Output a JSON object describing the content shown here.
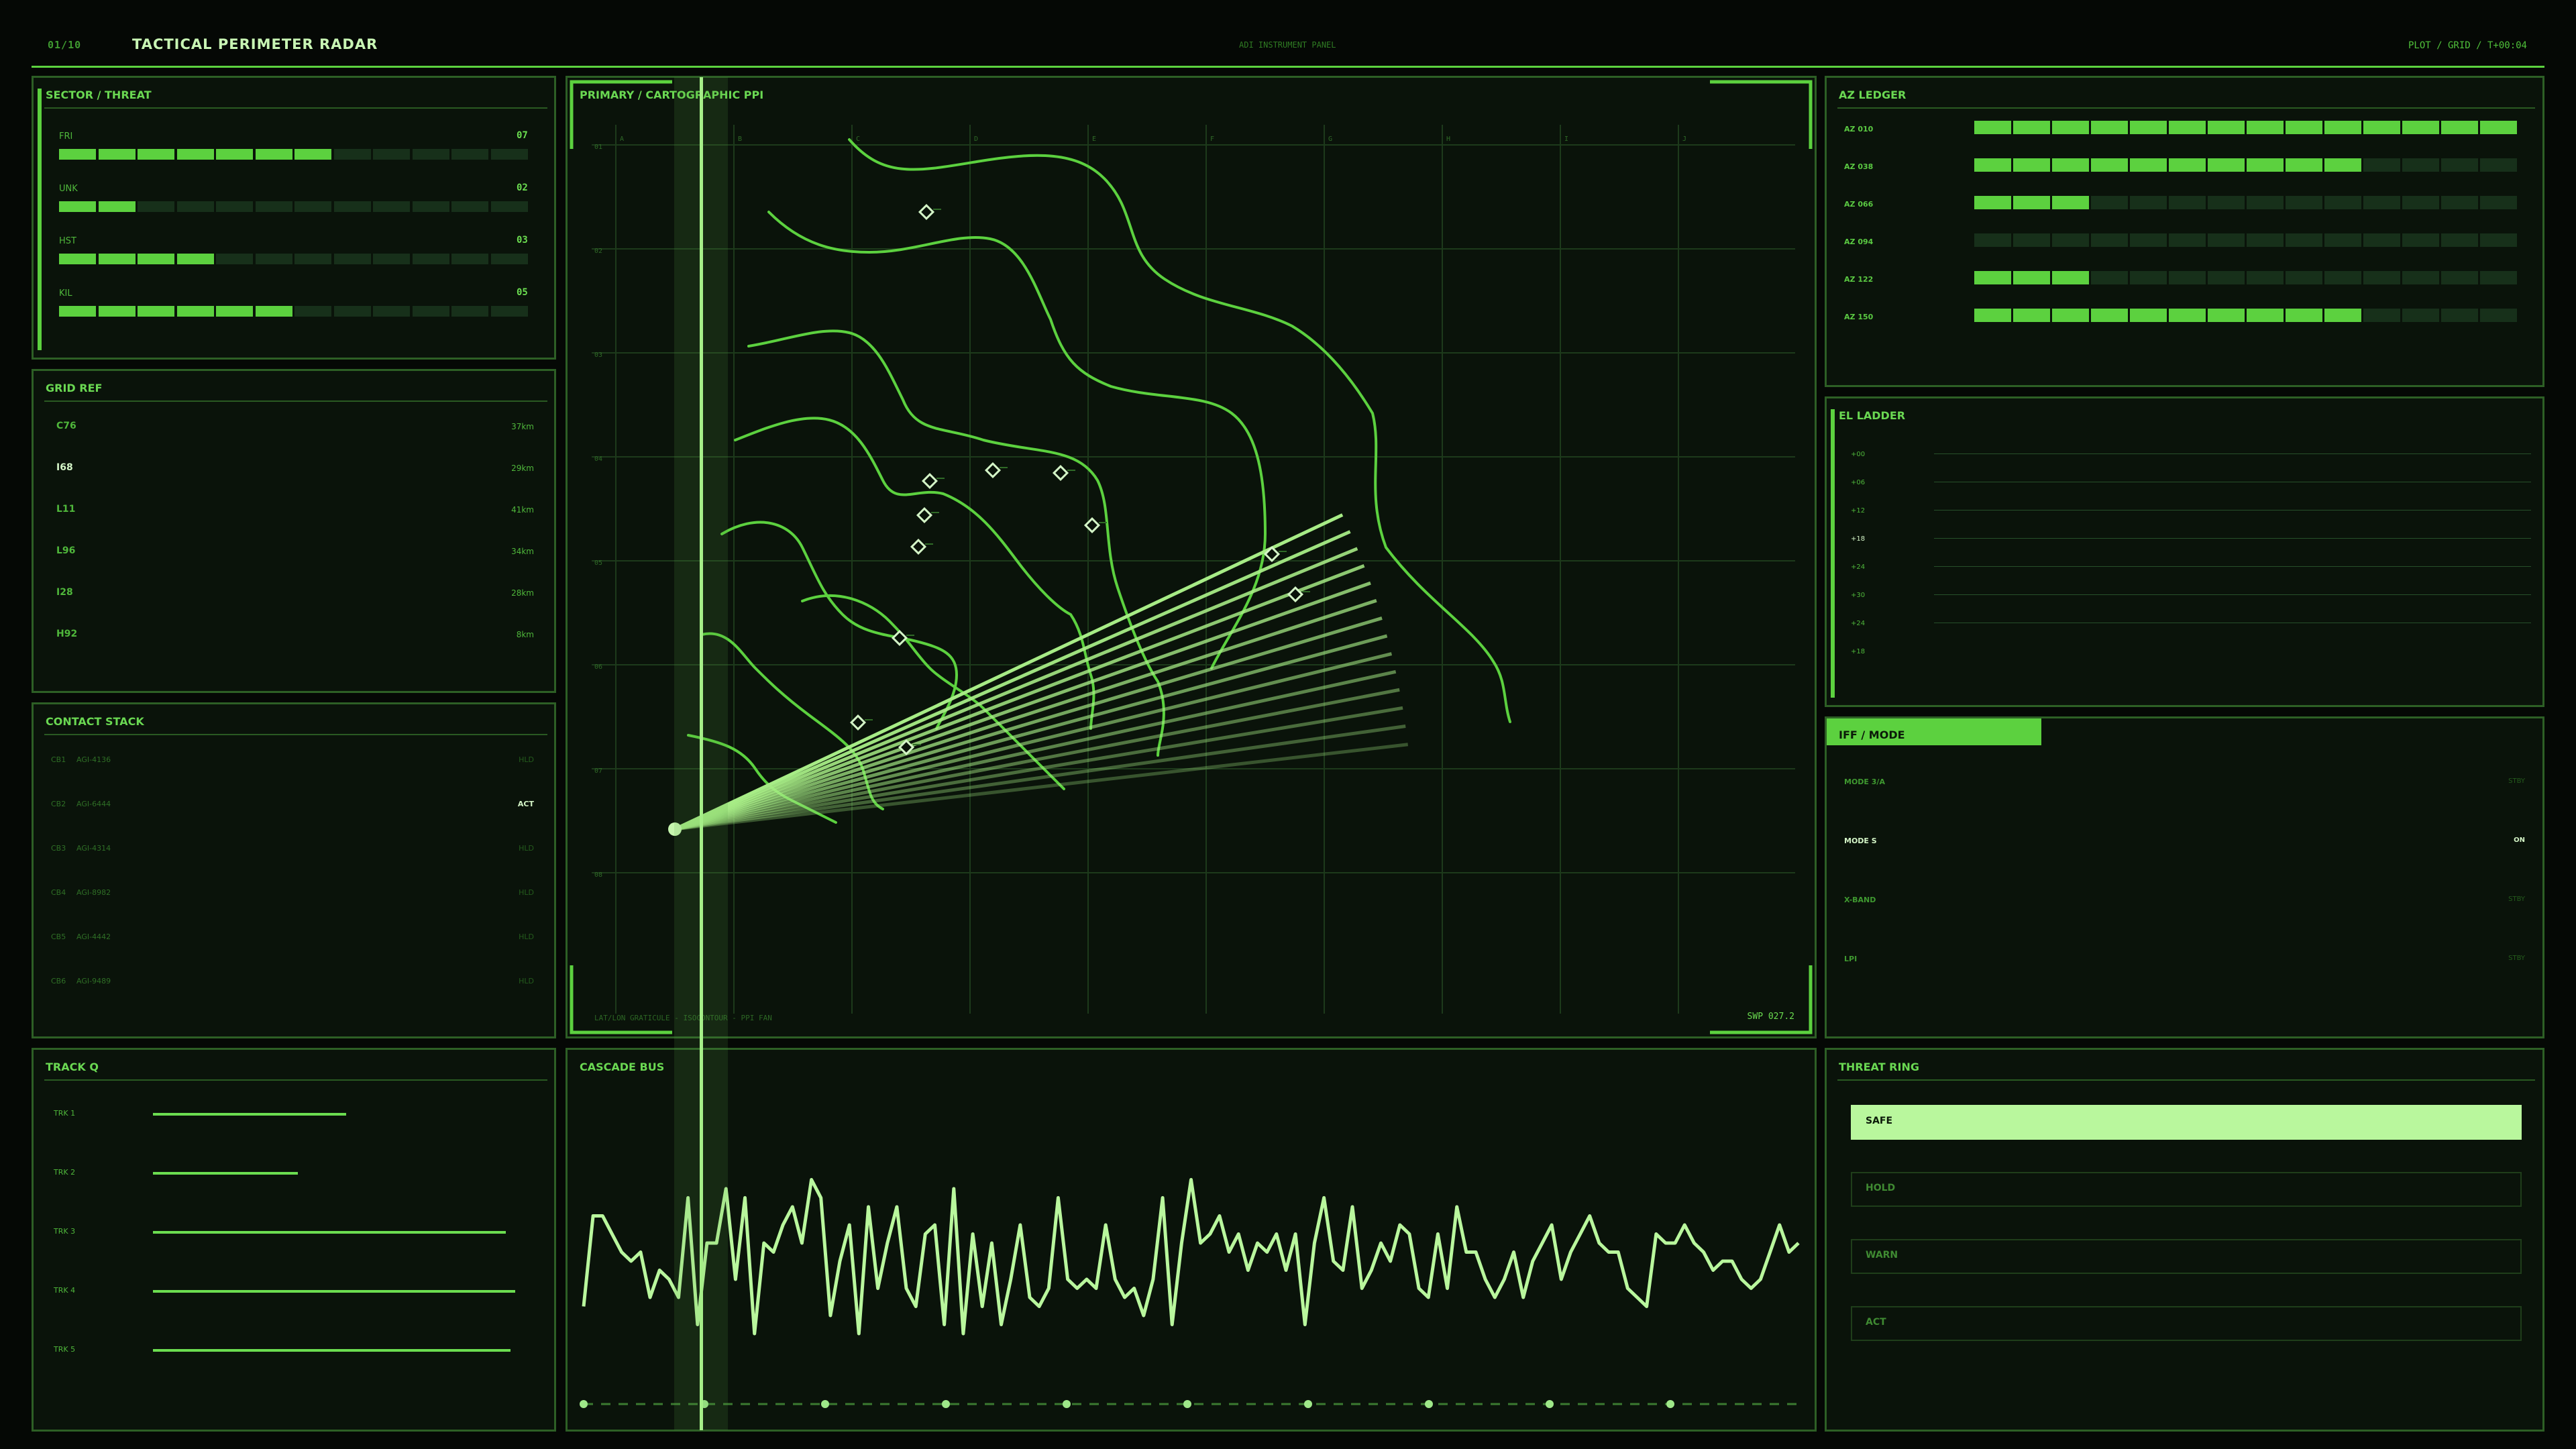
{
  "header": {
    "index": "01/10",
    "title": "TACTICAL PERIMETER RADAR",
    "center": "ADI INSTRUMENT PANEL",
    "right": "PLOT / GRID / T+00:04"
  },
  "sector": {
    "title": "SECTOR / THREAT",
    "rows": [
      {
        "label": "FRI",
        "value": "07",
        "fill": 0.583
      },
      {
        "label": "UNK",
        "value": "02",
        "fill": 0.167
      },
      {
        "label": "HST",
        "value": "03",
        "fill": 0.333
      },
      {
        "label": "KIL",
        "value": "05",
        "fill": 0.5
      }
    ]
  },
  "gridref": {
    "title": "GRID REF",
    "rows": [
      {
        "code": "C76",
        "dist": "37km"
      },
      {
        "code": "I68",
        "dist": "29km"
      },
      {
        "code": "L11",
        "dist": "41km"
      },
      {
        "code": "L96",
        "dist": "34km"
      },
      {
        "code": "I28",
        "dist": "28km"
      },
      {
        "code": "H92",
        "dist": "8km"
      }
    ]
  },
  "contacts": {
    "title": "CONTACT STACK",
    "rows": [
      {
        "id": "CB1",
        "code": "AGI-4136",
        "status": "HLD"
      },
      {
        "id": "CB2",
        "code": "AGI-6444",
        "status": "ACT"
      },
      {
        "id": "CB3",
        "code": "AGI-4314",
        "status": "HLD"
      },
      {
        "id": "CB4",
        "code": "AGI-8982",
        "status": "HLD"
      },
      {
        "id": "CB5",
        "code": "AGI-4442",
        "status": "HLD"
      },
      {
        "id": "CB6",
        "code": "AGI-9489",
        "status": "HLD"
      }
    ]
  },
  "trackq": {
    "title": "TRACK Q",
    "rows": [
      {
        "label": "TRK 1",
        "value": 0.4
      },
      {
        "label": "TRK 2",
        "value": 0.3
      },
      {
        "label": "TRK 3",
        "value": 0.73
      },
      {
        "label": "TRK 4",
        "value": 0.75
      },
      {
        "label": "TRK 5",
        "value": 0.74
      }
    ]
  },
  "ppi": {
    "title": "PRIMARY / CARTOGRAPHIC PPI",
    "footer": "LAT/LON GRATICULE - ISOCONTOUR - PPI FAN",
    "sweep": "SWP 027.2",
    "cols": [
      "A",
      "B",
      "C",
      "D",
      "E",
      "F",
      "G",
      "H",
      "I",
      "J"
    ],
    "rows": [
      "01",
      "02",
      "03",
      "04",
      "05",
      "06",
      "07",
      "08"
    ]
  },
  "cascade": {
    "title": "CASCADE BUS",
    "values": [
      0.25,
      0.75,
      0.75,
      0.65,
      0.55,
      0.5,
      0.55,
      0.3,
      0.45,
      0.4,
      0.3,
      0.85,
      0.15,
      0.6,
      0.6,
      0.9,
      0.4,
      0.85,
      0.1,
      0.6,
      0.55,
      0.7,
      0.8,
      0.6,
      0.95,
      0.85,
      0.2,
      0.5,
      0.7,
      0.1,
      0.8,
      0.35,
      0.6,
      0.8,
      0.35,
      0.25,
      0.65,
      0.7,
      0.15,
      0.9,
      0.1,
      0.65,
      0.25,
      0.6,
      0.15,
      0.4,
      0.7,
      0.3,
      0.25,
      0.35,
      0.85,
      0.4,
      0.35,
      0.4,
      0.35,
      0.7,
      0.4,
      0.3,
      0.35,
      0.2,
      0.4,
      0.85,
      0.15,
      0.6,
      0.95,
      0.6,
      0.65,
      0.75,
      0.55,
      0.65,
      0.45,
      0.6,
      0.55,
      0.65,
      0.45,
      0.65,
      0.15,
      0.6,
      0.85,
      0.5,
      0.45,
      0.8,
      0.35,
      0.45,
      0.6,
      0.5,
      0.7,
      0.65,
      0.35,
      0.3,
      0.65,
      0.35,
      0.8,
      0.55,
      0.55,
      0.4,
      0.3,
      0.4,
      0.55,
      0.3,
      0.5,
      0.6,
      0.7,
      0.4,
      0.55,
      0.65,
      0.75,
      0.6,
      0.55,
      0.55,
      0.35,
      0.3,
      0.25,
      0.65,
      0.6,
      0.6,
      0.7,
      0.6,
      0.55,
      0.45,
      0.5,
      0.5,
      0.4,
      0.35,
      0.4,
      0.55,
      0.7,
      0.55,
      0.6
    ]
  },
  "azledger": {
    "title": "AZ LEDGER",
    "rows": [
      {
        "label": "AZ 010",
        "fill": 1.0
      },
      {
        "label": "AZ 038",
        "fill": 0.714
      },
      {
        "label": "AZ 066",
        "fill": 0.214
      },
      {
        "label": "AZ 094",
        "fill": 0.0
      },
      {
        "label": "AZ 122",
        "fill": 0.214
      },
      {
        "label": "AZ 150",
        "fill": 0.714
      }
    ]
  },
  "elladder": {
    "title": "EL LADDER",
    "rows": [
      "+00",
      "+06",
      "+12",
      "+18",
      "+24",
      "+30",
      "+24",
      "+18"
    ]
  },
  "iff": {
    "title": "IFF / MODE",
    "rows": [
      {
        "label": "MODE 3/A",
        "status": "STBY"
      },
      {
        "label": "MODE S",
        "status": "ON"
      },
      {
        "label": "X-BAND",
        "status": "STBY"
      },
      {
        "label": "LPI",
        "status": "STBY"
      }
    ]
  },
  "threatring": {
    "title": "THREAT RING",
    "rows": [
      "SAFE",
      "HOLD",
      "WARN",
      "ACT"
    ],
    "active": 0
  },
  "colors": {
    "accent": "#5cd13f",
    "bright": "#b9f79d",
    "dim": "#1b3518",
    "bg": "#0a130a"
  }
}
